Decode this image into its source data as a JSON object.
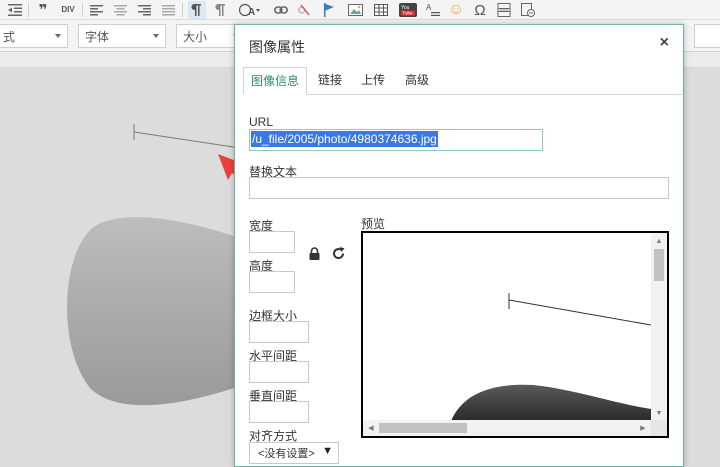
{
  "toolbar": {
    "blocks": [
      "❞",
      "DIV",
      "</>"
    ],
    "omega": "Ω",
    "smiley": "☺"
  },
  "format_bar": {
    "style_combo": "式",
    "font_combo": "字体",
    "size_combo": "大小"
  },
  "dialog": {
    "title": "图像属性",
    "close": "×",
    "tabs": [
      {
        "label": "图像信息",
        "active": true
      },
      {
        "label": "链接",
        "active": false
      },
      {
        "label": "上传",
        "active": false
      },
      {
        "label": "高级",
        "active": false
      }
    ],
    "url_label": "URL",
    "url_value": "/u_file/2005/photo/4980374636.jpg",
    "alt_label": "替换文本",
    "alt_value": "",
    "width_label": "宽度",
    "width_value": "",
    "height_label": "高度",
    "height_value": "",
    "border_label": "边框大小",
    "border_value": "",
    "hspace_label": "水平间距",
    "hspace_value": "",
    "vspace_label": "垂直间距",
    "vspace_value": "",
    "align_label": "对齐方式",
    "align_value": "<没有设置>",
    "preview_label": "预览"
  },
  "colors": {
    "accent": "#2a8c72",
    "dialog_border": "#6ab4a6",
    "selection": "#3b78e7",
    "arrow": "#e8423f"
  },
  "icons": {
    "lock": "lock-icon",
    "reset": "reset-size-icon",
    "close": "close-icon",
    "annotation": "red-arrow-annotation"
  }
}
